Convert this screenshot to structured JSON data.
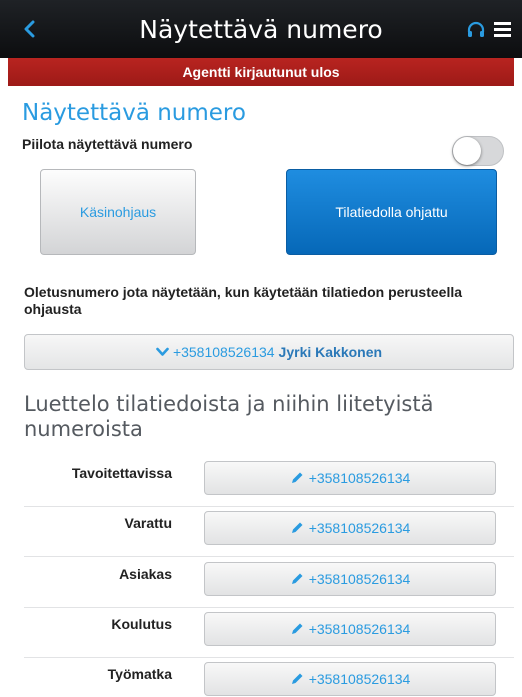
{
  "header": {
    "title": "Näytettävä numero",
    "back_icon": "chevron-left-icon",
    "headset_icon": "headset-icon",
    "menu_icon": "hamburger-menu-icon"
  },
  "status_banner": {
    "text": "Agentti kirjautunut ulos",
    "color": "#b22222"
  },
  "shown_number": {
    "section_title": "Näytettävä numero",
    "hide_label": "Piilota näytettävä numero",
    "hide_toggle_on": false,
    "modes": {
      "manual": "Käsinohjaus",
      "status_driven": "Tilatiedolla ohjattu",
      "selected": "status_driven"
    },
    "default_description": "Oletusnumero jota näytetään, kun käytetään tilatiedon perusteella ohjausta",
    "default_number": "+358108526134",
    "default_name": "Jyrki Kakkonen"
  },
  "status_list": {
    "title": "Luettelo tilatiedoista ja niihin liitetyistä numeroista",
    "rows": [
      {
        "label": "Tavoitettavissa",
        "number": "+358108526134"
      },
      {
        "label": "Varattu",
        "number": "+358108526134"
      },
      {
        "label": "Asiakas",
        "number": "+358108526134"
      },
      {
        "label": "Koulutus",
        "number": "+358108526134"
      },
      {
        "label": "Työmatka",
        "number": "+358108526134"
      }
    ]
  },
  "colors": {
    "accent": "#2a9be0",
    "primary_button": "#0a78cc",
    "header_bg": "#15171a"
  }
}
